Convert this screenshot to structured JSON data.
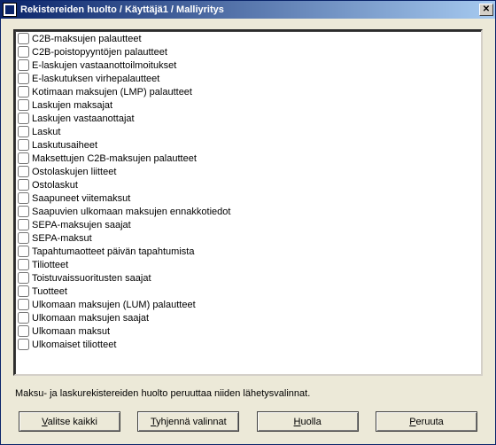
{
  "window": {
    "title": "Rekistereiden huolto / Käyttäjä1 / Malliyritys"
  },
  "list": {
    "items": [
      {
        "label": "C2B-maksujen palautteet",
        "checked": false
      },
      {
        "label": "C2B-poistopyyntöjen palautteet",
        "checked": false
      },
      {
        "label": "E-laskujen vastaanottoilmoitukset",
        "checked": false
      },
      {
        "label": "E-laskutuksen virhepalautteet",
        "checked": false
      },
      {
        "label": "Kotimaan maksujen (LMP) palautteet",
        "checked": false
      },
      {
        "label": "Laskujen maksajat",
        "checked": false
      },
      {
        "label": "Laskujen vastaanottajat",
        "checked": false
      },
      {
        "label": "Laskut",
        "checked": false
      },
      {
        "label": "Laskutusaiheet",
        "checked": false
      },
      {
        "label": "Maksettujen C2B-maksujen palautteet",
        "checked": false
      },
      {
        "label": "Ostolaskujen liitteet",
        "checked": false
      },
      {
        "label": "Ostolaskut",
        "checked": false
      },
      {
        "label": "Saapuneet viitemaksut",
        "checked": false
      },
      {
        "label": "Saapuvien ulkomaan maksujen ennakkotiedot",
        "checked": false
      },
      {
        "label": "SEPA-maksujen saajat",
        "checked": false
      },
      {
        "label": "SEPA-maksut",
        "checked": false
      },
      {
        "label": "Tapahtumaotteet päivän tapahtumista",
        "checked": false
      },
      {
        "label": "Tiliotteet",
        "checked": false
      },
      {
        "label": "Toistuvaissuoritusten saajat",
        "checked": false
      },
      {
        "label": "Tuotteet",
        "checked": false
      },
      {
        "label": "Ulkomaan maksujen (LUM) palautteet",
        "checked": false
      },
      {
        "label": "Ulkomaan maksujen saajat",
        "checked": false
      },
      {
        "label": "Ulkomaan maksut",
        "checked": false
      },
      {
        "label": "Ulkomaiset tiliotteet",
        "checked": false
      }
    ]
  },
  "note": "Maksu- ja laskurekistereiden huolto peruuttaa niiden lähetysvalinnat.",
  "buttons": {
    "select_all": {
      "label": "Valitse kaikki",
      "accel_index": 0
    },
    "clear": {
      "label": "Tyhjennä valinnat",
      "accel_index": 0
    },
    "maintain": {
      "label": "Huolla",
      "accel_index": 0
    },
    "cancel": {
      "label": "Peruuta",
      "accel_index": 0
    }
  }
}
